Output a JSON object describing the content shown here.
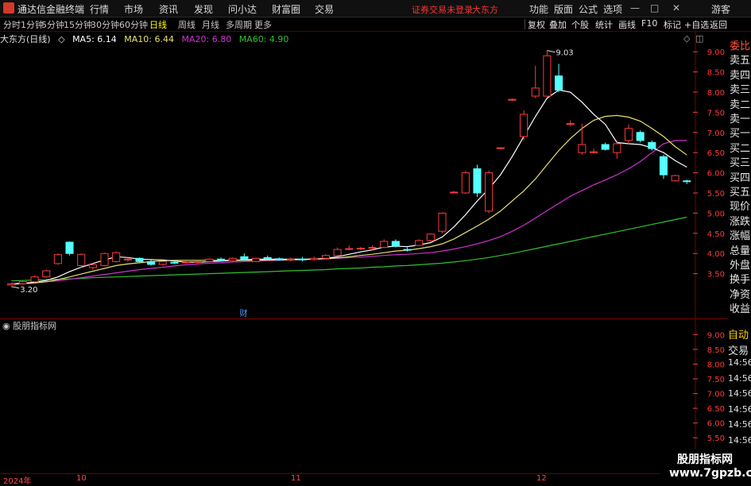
{
  "app": {
    "title": "通达信金融终端",
    "menu": [
      "行情",
      "市场",
      "资讯",
      "发现",
      "问小达",
      "财富圈",
      "交易"
    ],
    "warning": "证券交易未登录",
    "stock_name_top": "大东方",
    "right_menu": [
      "功能",
      "版面",
      "公式",
      "选项"
    ],
    "guest": "游客",
    "win_min": "—",
    "win_max": "□",
    "win_close": "✕"
  },
  "colors": {
    "ma5": "#ffffff",
    "ma10": "#e8e070",
    "ma20": "#d030d0",
    "ma60": "#30c030",
    "up": "#ff3a3a",
    "down": "#54ffff",
    "axis": "#ff3a3a",
    "bg": "#000000"
  },
  "periods": {
    "items": [
      "分时",
      "1分钟",
      "5分钟",
      "15分钟",
      "30分钟",
      "60分钟",
      "日线",
      "周线",
      "月线",
      "多周期",
      "更多"
    ],
    "active": "日线"
  },
  "toolbar": [
    "复权",
    "叠加",
    "个股",
    "统计",
    "画线",
    "F10",
    "标记",
    "+自选",
    "返回"
  ],
  "legend": {
    "name": "大东方(日线)",
    "ma5": "MA5: 6.14",
    "ma10": "MA10: 6.44",
    "ma20": "MA20: 6.80",
    "ma60": "MA60: 4.90"
  },
  "side_panel": [
    "委比",
    "卖五",
    "卖四",
    "卖三",
    "卖二",
    "卖一",
    "买一",
    "买二",
    "买三",
    "买四",
    "买五",
    "现价",
    "涨跌",
    "涨幅",
    "总量",
    "外盘",
    "换手",
    "净资",
    "收益"
  ],
  "sub_panel": {
    "title": "股朋指标网",
    "labels": [
      "自动",
      "交易",
      "14:56",
      "14:56",
      "14:56",
      "14:56",
      "14:56",
      "14:56",
      "14:56",
      "14:56"
    ]
  },
  "annotations": {
    "high": "9.03",
    "low": "3.20",
    "event": "财"
  },
  "time_axis": {
    "labels": [
      "2024年",
      "10",
      "11",
      "12"
    ]
  },
  "watermark": {
    "line1": "股朋指标网",
    "line2": "www.7gpzb.com"
  },
  "chart_data": {
    "type": "candlestick",
    "title": "大东方(日线)",
    "ylim": [
      3.0,
      9.2
    ],
    "y_ticks": [
      3.5,
      4.0,
      4.5,
      5.0,
      5.5,
      6.0,
      6.5,
      7.0,
      7.5,
      8.0,
      8.5,
      9.0
    ],
    "sub_ylim": [
      4.4,
      9.2
    ],
    "sub_y_ticks": [
      4.5,
      5.0,
      5.5,
      6.0,
      6.5,
      7.0,
      7.5,
      8.0,
      8.5,
      9.0
    ],
    "ohlc": [
      [
        3.22,
        3.26,
        3.2,
        3.25
      ],
      [
        3.25,
        3.32,
        3.23,
        3.3
      ],
      [
        3.3,
        3.45,
        3.28,
        3.42
      ],
      [
        3.42,
        3.6,
        3.4,
        3.57
      ],
      [
        3.75,
        4.0,
        3.72,
        3.97
      ],
      [
        4.28,
        4.3,
        3.95,
        4.0
      ],
      [
        3.7,
        4.0,
        3.65,
        3.98
      ],
      [
        3.65,
        3.75,
        3.6,
        3.72
      ],
      [
        3.7,
        4.02,
        3.68,
        4.0
      ],
      [
        3.8,
        4.05,
        3.78,
        4.02
      ],
      [
        3.85,
        3.92,
        3.8,
        3.86
      ],
      [
        3.88,
        3.9,
        3.78,
        3.8
      ],
      [
        3.8,
        3.85,
        3.7,
        3.73
      ],
      [
        3.73,
        3.82,
        3.7,
        3.8
      ],
      [
        3.78,
        3.82,
        3.74,
        3.77
      ],
      [
        3.77,
        3.81,
        3.75,
        3.79
      ],
      [
        3.79,
        3.83,
        3.76,
        3.8
      ],
      [
        3.8,
        3.88,
        3.78,
        3.86
      ],
      [
        3.86,
        3.9,
        3.8,
        3.82
      ],
      [
        3.82,
        3.9,
        3.8,
        3.88
      ],
      [
        3.92,
        4.0,
        3.82,
        3.85
      ],
      [
        3.8,
        3.9,
        3.78,
        3.88
      ],
      [
        3.9,
        3.95,
        3.85,
        3.87
      ],
      [
        3.87,
        3.9,
        3.82,
        3.84
      ],
      [
        3.84,
        3.9,
        3.8,
        3.86
      ],
      [
        3.86,
        3.92,
        3.8,
        3.85
      ],
      [
        3.85,
        3.92,
        3.82,
        3.88
      ],
      [
        3.88,
        3.98,
        3.85,
        3.95
      ],
      [
        3.95,
        4.15,
        3.93,
        4.1
      ],
      [
        4.1,
        4.2,
        4.08,
        4.12
      ],
      [
        4.12,
        4.16,
        4.09,
        4.13
      ],
      [
        4.13,
        4.2,
        4.08,
        4.15
      ],
      [
        4.15,
        4.35,
        4.13,
        4.3
      ],
      [
        4.3,
        4.35,
        4.15,
        4.18
      ],
      [
        4.1,
        4.15,
        4.05,
        4.08
      ],
      [
        4.2,
        4.35,
        4.18,
        4.32
      ],
      [
        4.32,
        4.5,
        4.3,
        4.48
      ],
      [
        4.55,
        5.02,
        4.5,
        5.0
      ],
      [
        5.52,
        5.55,
        5.5,
        5.52
      ],
      [
        5.5,
        6.05,
        5.48,
        6.0
      ],
      [
        6.1,
        6.2,
        5.4,
        5.5
      ],
      [
        5.05,
        6.05,
        5.0,
        6.0
      ],
      [
        6.6,
        6.63,
        6.58,
        6.62
      ],
      [
        7.8,
        7.84,
        7.78,
        7.82
      ],
      [
        6.9,
        7.55,
        6.8,
        7.45
      ],
      [
        7.9,
        8.65,
        7.85,
        8.1
      ],
      [
        7.9,
        9.03,
        7.88,
        8.9
      ],
      [
        8.4,
        8.7,
        8.0,
        8.05
      ],
      [
        7.2,
        7.3,
        7.15,
        7.22
      ],
      [
        6.5,
        7.22,
        6.45,
        6.7
      ],
      [
        6.5,
        6.6,
        6.48,
        6.52
      ],
      [
        6.7,
        6.75,
        6.55,
        6.58
      ],
      [
        6.5,
        6.8,
        6.35,
        6.72
      ],
      [
        6.8,
        7.2,
        6.7,
        7.1
      ],
      [
        7.0,
        7.05,
        6.75,
        6.8
      ],
      [
        6.75,
        6.8,
        6.55,
        6.6
      ],
      [
        6.4,
        6.45,
        5.85,
        5.95
      ],
      [
        5.8,
        5.95,
        5.78,
        5.93
      ],
      [
        5.8,
        5.83,
        5.72,
        5.78
      ]
    ],
    "ma5": [
      3.24,
      3.26,
      3.29,
      3.33,
      3.42,
      3.55,
      3.66,
      3.75,
      3.84,
      3.92,
      3.9,
      3.86,
      3.85,
      3.84,
      3.81,
      3.79,
      3.78,
      3.8,
      3.81,
      3.83,
      3.84,
      3.86,
      3.86,
      3.86,
      3.86,
      3.86,
      3.86,
      3.88,
      3.92,
      3.98,
      4.04,
      4.09,
      4.16,
      4.18,
      4.17,
      4.21,
      4.27,
      4.41,
      4.66,
      4.96,
      5.3,
      5.6,
      5.95,
      6.4,
      6.9,
      7.4,
      7.85,
      8.05,
      8.0,
      7.75,
      7.45,
      7.2,
      6.75,
      6.72,
      6.7,
      6.62,
      6.5,
      6.3,
      6.14
    ],
    "ma10": [
      3.24,
      3.25,
      3.27,
      3.3,
      3.35,
      3.42,
      3.49,
      3.56,
      3.63,
      3.7,
      3.74,
      3.77,
      3.8,
      3.82,
      3.83,
      3.83,
      3.83,
      3.83,
      3.83,
      3.83,
      3.83,
      3.83,
      3.84,
      3.84,
      3.84,
      3.85,
      3.86,
      3.87,
      3.89,
      3.92,
      3.95,
      3.98,
      4.02,
      4.06,
      4.08,
      4.12,
      4.17,
      4.24,
      4.36,
      4.52,
      4.68,
      4.85,
      5.05,
      5.3,
      5.55,
      5.85,
      6.2,
      6.55,
      6.85,
      7.1,
      7.3,
      7.4,
      7.42,
      7.38,
      7.28,
      7.1,
      6.9,
      6.65,
      6.44
    ],
    "ma20": [
      3.26,
      3.27,
      3.28,
      3.3,
      3.32,
      3.36,
      3.4,
      3.44,
      3.48,
      3.52,
      3.56,
      3.6,
      3.63,
      3.66,
      3.69,
      3.72,
      3.74,
      3.76,
      3.77,
      3.79,
      3.8,
      3.81,
      3.82,
      3.83,
      3.84,
      3.85,
      3.86,
      3.87,
      3.88,
      3.9,
      3.91,
      3.93,
      3.95,
      3.97,
      3.98,
      4.0,
      4.02,
      4.06,
      4.11,
      4.17,
      4.24,
      4.32,
      4.42,
      4.55,
      4.7,
      4.88,
      5.06,
      5.24,
      5.42,
      5.56,
      5.7,
      5.82,
      5.95,
      6.1,
      6.28,
      6.5,
      6.72,
      6.8,
      6.8
    ],
    "ma60": [
      3.32,
      3.33,
      3.34,
      3.35,
      3.36,
      3.37,
      3.38,
      3.4,
      3.41,
      3.42,
      3.43,
      3.44,
      3.45,
      3.46,
      3.47,
      3.48,
      3.49,
      3.5,
      3.51,
      3.52,
      3.53,
      3.54,
      3.55,
      3.56,
      3.57,
      3.58,
      3.59,
      3.6,
      3.62,
      3.63,
      3.64,
      3.66,
      3.67,
      3.69,
      3.7,
      3.72,
      3.74,
      3.76,
      3.79,
      3.82,
      3.86,
      3.9,
      3.95,
      4.0,
      4.06,
      4.12,
      4.18,
      4.24,
      4.3,
      4.36,
      4.42,
      4.48,
      4.54,
      4.6,
      4.66,
      4.72,
      4.78,
      4.84,
      4.9
    ]
  }
}
